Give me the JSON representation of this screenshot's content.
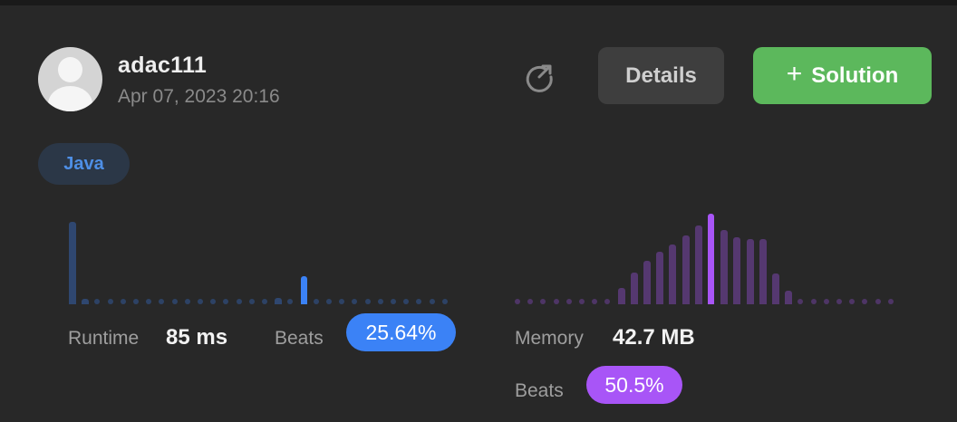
{
  "user": {
    "name": "adac111",
    "submitted_at": "Apr 07, 2023 20:16"
  },
  "header": {
    "refresh_icon": "share-refresh-icon",
    "details_label": "Details",
    "solution_label": "Solution",
    "solution_icon": "plus-icon"
  },
  "language": "Java",
  "runtime": {
    "label": "Runtime",
    "value": "85 ms",
    "beats_label": "Beats",
    "beats": "25.64%",
    "color": "#3b82f6",
    "highlight_index": 18,
    "distribution": [
      0.95,
      0.06,
      0.03,
      0.03,
      0.03,
      0.03,
      0.03,
      0.03,
      0.03,
      0.03,
      0.03,
      0.03,
      0.03,
      0.03,
      0.03,
      0.03,
      0.07,
      0.03,
      0.32,
      0.03,
      0.03,
      0.03,
      0.03,
      0.03,
      0.03,
      0.03,
      0.03,
      0.03,
      0.03,
      0.03
    ]
  },
  "memory": {
    "label": "Memory",
    "value": "42.7 MB",
    "beats_label": "Beats",
    "beats": "50.5%",
    "color": "#a855f7",
    "highlight_index": 15,
    "distribution": [
      0.03,
      0.03,
      0.03,
      0.03,
      0.03,
      0.03,
      0.03,
      0.03,
      0.18,
      0.35,
      0.48,
      0.58,
      0.66,
      0.76,
      0.87,
      1.0,
      0.82,
      0.74,
      0.72,
      0.72,
      0.34,
      0.15,
      0.03,
      0.03,
      0.03,
      0.03,
      0.03,
      0.03,
      0.03,
      0.03
    ]
  }
}
